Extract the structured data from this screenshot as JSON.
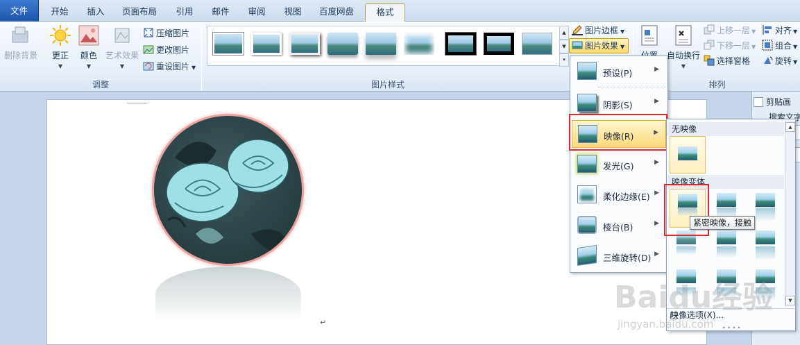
{
  "tabs": [
    {
      "label": "文件",
      "name": "tab-file"
    },
    {
      "label": "开始",
      "name": "tab-home"
    },
    {
      "label": "插入",
      "name": "tab-insert"
    },
    {
      "label": "页面布局",
      "name": "tab-page-layout"
    },
    {
      "label": "引用",
      "name": "tab-references"
    },
    {
      "label": "邮件",
      "name": "tab-mailings"
    },
    {
      "label": "审阅",
      "name": "tab-review"
    },
    {
      "label": "视图",
      "name": "tab-view"
    },
    {
      "label": "百度网盘",
      "name": "tab-baidu-netdisk"
    },
    {
      "label": "格式",
      "name": "tab-format"
    }
  ],
  "ribbon": {
    "adjust": {
      "remove_background": "删除背景",
      "corrections": "更正",
      "color": "颜色",
      "artistic_effects": "艺术效果",
      "compress": "压缩图片",
      "change": "更改图片",
      "reset": "重设图片",
      "group_label": "调整"
    },
    "styles": {
      "group_label": "图片样式",
      "border": "图片边框",
      "effects": "图片效果"
    },
    "arrange": {
      "position": "位置",
      "wrap": "自动换行",
      "bring_forward": "上移一层",
      "send_backward": "下移一层",
      "selection_pane": "选择窗格",
      "align": "对齐",
      "group": "组合",
      "rotate": "旋转",
      "group_label": "排列"
    }
  },
  "effects_menu": {
    "items": [
      {
        "label": "预设(P)"
      },
      {
        "label": "阴影(S)"
      },
      {
        "label": "映像(R)"
      },
      {
        "label": "发光(G)"
      },
      {
        "label": "柔化边缘(E)"
      },
      {
        "label": "棱台(B)"
      },
      {
        "label": "三维旋转(D)"
      }
    ]
  },
  "reflection_submenu": {
    "no_reflection_header": "无映像",
    "variations_header": "映像变体",
    "tooltip": "紧密映像，接触",
    "options_label": "映像选项(X)..."
  },
  "right_pane": {
    "clipart": "剪贴画",
    "search": "搜索文字"
  },
  "watermark": {
    "logo": "Baidu经验",
    "url": "jingyan.baidu.com"
  },
  "colors": {
    "file_tab": "#2a66bd",
    "highlight": "#ffd97a",
    "red_annotation": "#d8282d",
    "image_border": "#e9a2a0"
  }
}
